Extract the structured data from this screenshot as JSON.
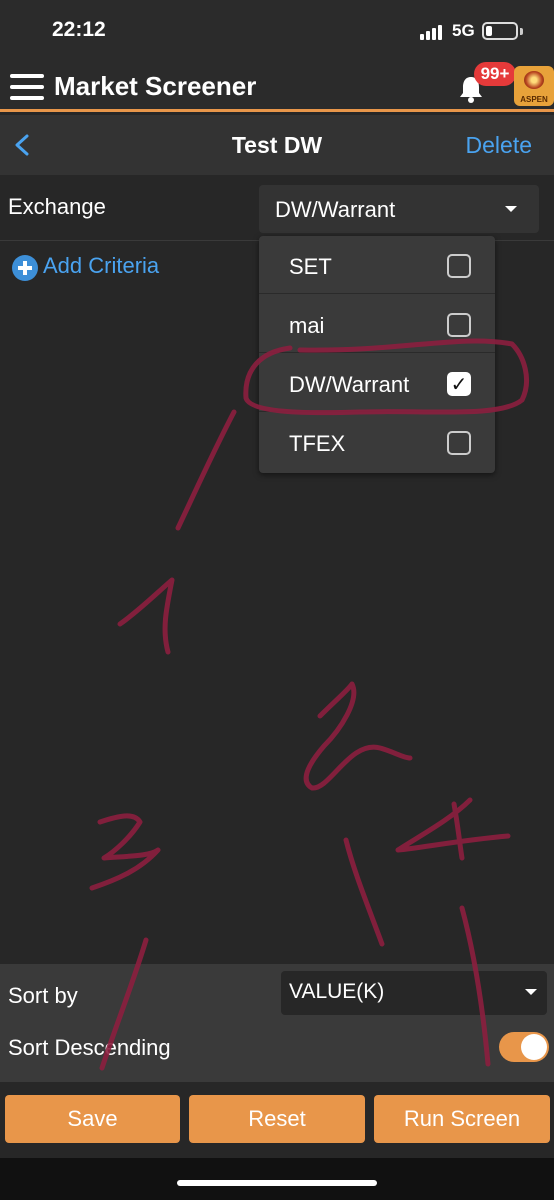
{
  "status_bar": {
    "time": "22:12",
    "network": "5G"
  },
  "header": {
    "title": "Market Screener",
    "notification_badge": "99+",
    "logo_text": "ASPEN",
    "accent_color": "#e8964a"
  },
  "subheader": {
    "back_icon": "chevron-left-icon",
    "title": "Test DW",
    "delete_label": "Delete"
  },
  "exchange": {
    "label": "Exchange",
    "selected": "DW/Warrant"
  },
  "add_criteria": {
    "label": "Add Criteria"
  },
  "dropdown": {
    "options": [
      {
        "label": "SET",
        "checked": false
      },
      {
        "label": "mai",
        "checked": false
      },
      {
        "label": "DW/Warrant",
        "checked": true
      },
      {
        "label": "TFEX",
        "checked": false
      }
    ]
  },
  "sort": {
    "label": "Sort by",
    "value": "VALUE(K)",
    "descending_label": "Sort Descending",
    "descending": true
  },
  "buttons": {
    "save": "Save",
    "reset": "Reset",
    "run": "Run Screen"
  },
  "icons": {
    "menu": "hamburger-menu-icon",
    "bell": "bell-icon",
    "add": "plus-circle-icon",
    "dropdown": "caret-down-icon"
  }
}
